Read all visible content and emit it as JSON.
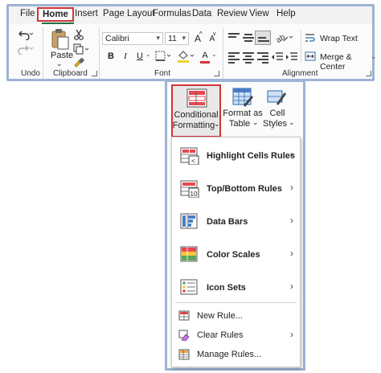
{
  "menubar": {
    "tabs": [
      "File",
      "Home",
      "Insert",
      "Page Layout",
      "Formulas",
      "Data",
      "Review",
      "View",
      "Help"
    ],
    "active_tab": "Home"
  },
  "groups": {
    "undo": "Undo",
    "clipboard": "Clipboard",
    "font": "Font",
    "alignment": "Alignment"
  },
  "clipboard": {
    "paste_label": "Paste",
    "paste_chevron": "⌄"
  },
  "font": {
    "name": "Calibri",
    "size": "11",
    "grow": "A",
    "shrink": "A",
    "bold": "B",
    "italic": "I",
    "underline": "U",
    "color_letter": "A"
  },
  "alignment": {
    "wrap_text": "Wrap Text",
    "merge_center": "Merge & Center"
  },
  "styles": {
    "conditional_formatting": "Conditional Formatting",
    "cf_line1": "Conditional",
    "cf_line2": "Formatting",
    "format_as_table_line1": "Format as",
    "format_as_table_line2": "Table",
    "cell_styles_line1": "Cell",
    "cell_styles_line2": "Styles",
    "chevron": "⌄"
  },
  "menu": {
    "items": [
      {
        "label": "Highlight Cells Rules",
        "icon": "highlight-cells-icon"
      },
      {
        "label": "Top/Bottom Rules",
        "icon": "top-bottom-icon"
      },
      {
        "label": "Data Bars",
        "icon": "data-bars-icon"
      },
      {
        "label": "Color Scales",
        "icon": "color-scales-icon"
      },
      {
        "label": "Icon Sets",
        "icon": "icon-sets-icon"
      }
    ],
    "new_rule": "New Rule...",
    "clear_rules": "Clear Rules",
    "manage_rules": "Manage Rules...",
    "arrow": "›"
  },
  "colors": {
    "accent_green": "#217346",
    "highlight_red": "#d13438",
    "frame_blue": "#9db4d4",
    "bar_blue": "#4a7ec4",
    "bar_red": "#e8484f",
    "bar_yellow": "#f3c63f",
    "bar_green": "#5aa85a"
  }
}
